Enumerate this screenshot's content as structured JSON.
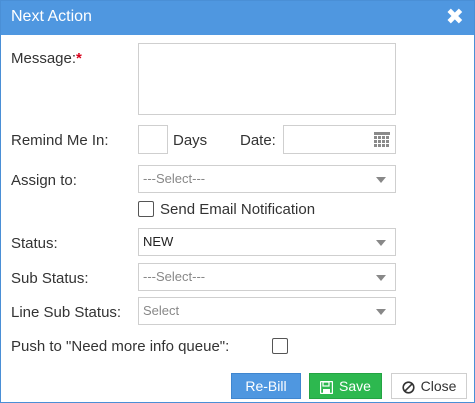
{
  "dialog": {
    "title": "Next Action",
    "close_icon": "close-x-icon"
  },
  "form": {
    "message_label": "Message:",
    "required_marker": "*",
    "message_value": "",
    "remind_label": "Remind Me In:",
    "remind_value": "",
    "days_label": "Days",
    "date_label": "Date:",
    "date_value": "",
    "assign_label": "Assign to:",
    "assign_value": "---Select---",
    "send_email_label": "Send Email Notification",
    "send_email_checked": false,
    "status_label": "Status:",
    "status_value": "NEW",
    "sub_status_label": "Sub Status:",
    "sub_status_value": "---Select---",
    "line_sub_status_label": "Line Sub Status:",
    "line_sub_status_value": "Select",
    "push_label": "Push to \"Need more info queue\":",
    "push_checked": false
  },
  "buttons": {
    "rebill_label": "Re-Bill",
    "save_label": "Save",
    "close_label": "Close"
  },
  "colors": {
    "header": "#4f97e0",
    "save": "#2db84f",
    "required": "#d9001b"
  }
}
